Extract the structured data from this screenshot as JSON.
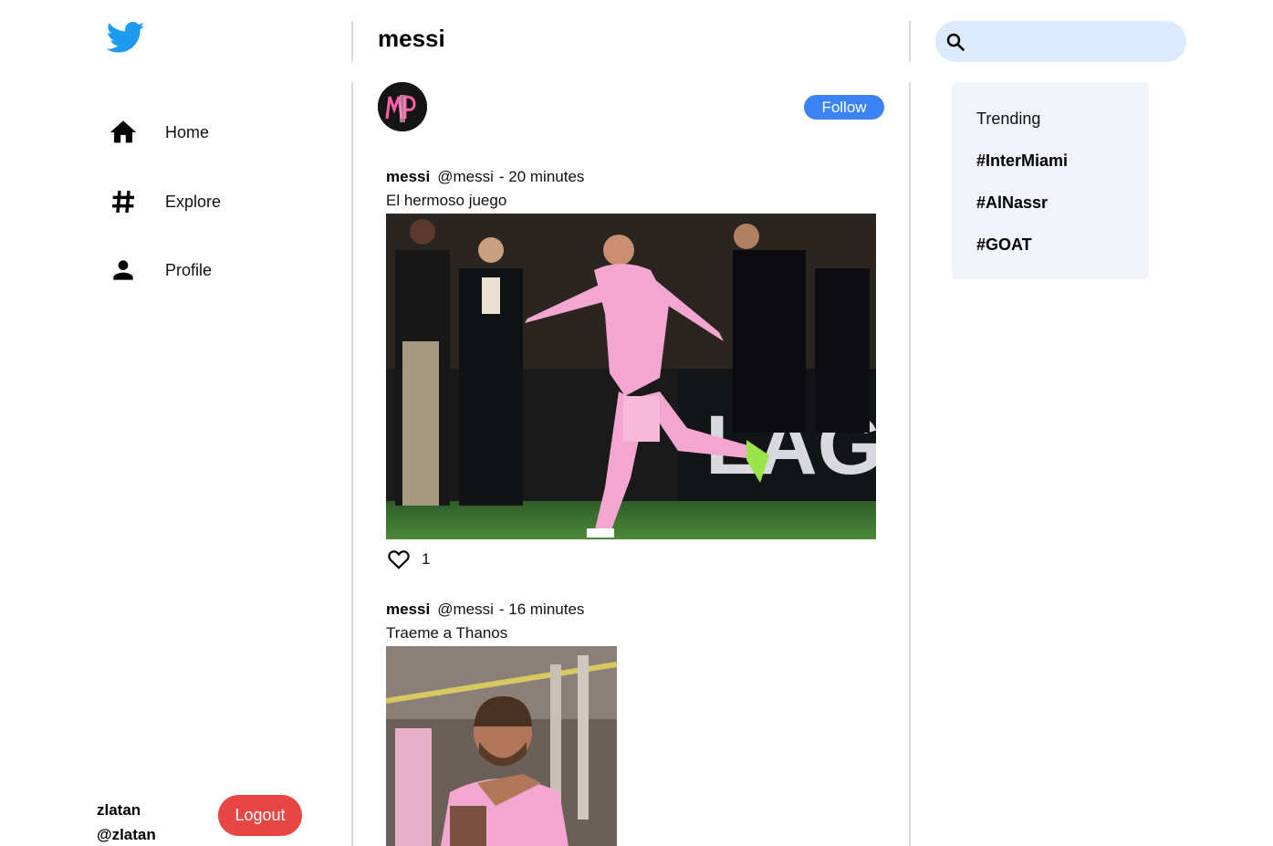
{
  "sidebar": {
    "logo_icon": "twitter-bird-icon",
    "brand_color": "#1d9bf0",
    "items": [
      {
        "label": "Home",
        "icon": "home-icon"
      },
      {
        "label": "Explore",
        "icon": "hashtag-icon"
      },
      {
        "label": "Profile",
        "icon": "person-icon"
      }
    ],
    "user": {
      "name": "zlatan",
      "handle": "@zlatan"
    },
    "logout_label": "Logout",
    "logout_color": "#e84545"
  },
  "header": {
    "title": "messi"
  },
  "profile": {
    "avatar_icon": "messi-avatar",
    "follow_label": "Follow",
    "follow_color": "#3b82f6"
  },
  "posts": [
    {
      "name": "messi",
      "handle": "@messi",
      "time": "- 20 minutes",
      "text": "El hermoso juego",
      "image": "messi-celebrating-photo",
      "likes": "1"
    },
    {
      "name": "messi",
      "handle": "@messi",
      "time": "- 16 minutes",
      "text": "Traeme a Thanos",
      "image": "messi-pointing-photo"
    }
  ],
  "search": {
    "placeholder": "",
    "icon": "search-icon",
    "bg_color": "#dbeafe"
  },
  "trending": {
    "title": "Trending",
    "tags": [
      "#InterMiami",
      "#AlNassr",
      "#GOAT"
    ]
  }
}
